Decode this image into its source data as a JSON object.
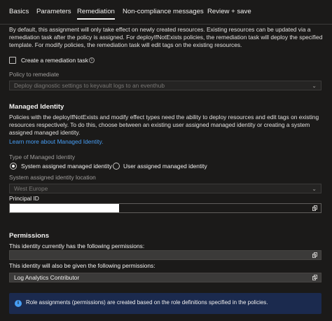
{
  "tabs": [
    {
      "label": "Basics"
    },
    {
      "label": "Parameters"
    },
    {
      "label": "Remediation"
    },
    {
      "label": "Non-compliance messages"
    },
    {
      "label": "Review + save"
    }
  ],
  "intro_text": "By default, this assignment will only take effect on newly created resources. Existing resources can be updated via a remediation task after the policy is assigned. For deployIfNotExists policies, the remediation task will deploy the specified template. For modify policies, the remediation task will edit tags on the existing resources.",
  "remediation": {
    "checkbox_label": "Create a remediation task",
    "checked": false,
    "policy_label": "Policy to remediate",
    "policy_value": "Deploy diagnostic settings to keyvault logs to an eventhub"
  },
  "identity": {
    "heading": "Managed Identity",
    "description": "Policies with the deployIfNotExists and modify effect types need the ability to deploy resources and edit tags on existing resources respectively. To do this, choose between an existing user assigned managed identity or creating a system assigned managed identity.",
    "learn_more": "Learn more about Managed Identity.",
    "type_label": "Type of Managed Identity",
    "options": [
      {
        "label": "System assigned managed identity",
        "selected": true
      },
      {
        "label": "User assigned managed identity",
        "selected": false
      }
    ],
    "location_label": "System assigned identity location",
    "location_value": "West Europe",
    "principal_label": "Principal ID",
    "principal_value": ""
  },
  "permissions": {
    "heading": "Permissions",
    "current_label": "This identity currently has the following permissions:",
    "current_value": "",
    "future_label": "This identity will also be given the following permissions:",
    "future_value": "Log Analytics Contributor"
  },
  "banner": {
    "text": "Role assignments (permissions) are created based on the role definitions specified in the policies."
  },
  "colors": {
    "background": "#1b1a19",
    "accent_link": "#479ef5",
    "banner_bg": "#1b2a4e"
  }
}
